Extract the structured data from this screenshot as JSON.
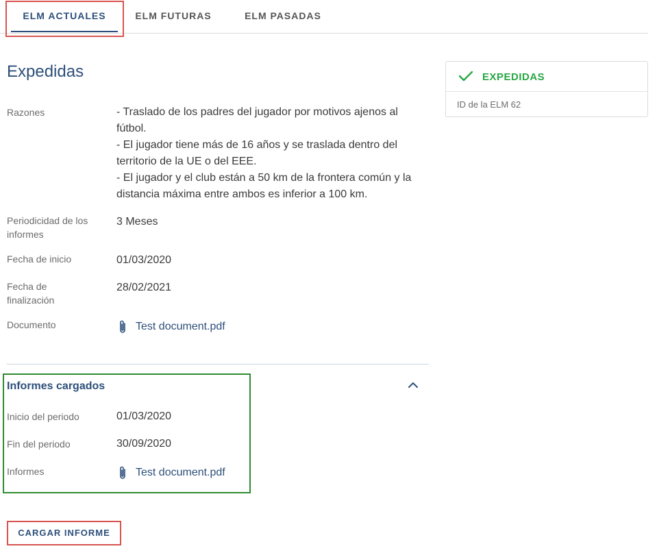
{
  "tabs": [
    {
      "label": "ELM ACTUALES",
      "active": true
    },
    {
      "label": "ELM FUTURAS",
      "active": false
    },
    {
      "label": "ELM PASADAS",
      "active": false
    }
  ],
  "main": {
    "title": "Expedidas",
    "fields": {
      "razones_label": "Razones",
      "razones": [
        "- Traslado de los padres del jugador por motivos ajenos al",
        "fútbol.",
        "- El jugador tiene más de 16 años y se traslada dentro del",
        "territorio de la UE o del EEE.",
        "- El jugador y el club están a 50 km de la frontera común y la",
        "distancia máxima entre ambos es inferior a 100 km."
      ],
      "periodicidad_label_1": "Periodicidad de los",
      "periodicidad_label_2": "informes",
      "periodicidad": "3 Meses",
      "fecha_inicio_label": "Fecha de inicio",
      "fecha_inicio": "01/03/2020",
      "fecha_fin_label_1": "Fecha de",
      "fecha_fin_label_2": "finalización",
      "fecha_fin": "28/02/2021",
      "documento_label": "Documento",
      "documento": "Test document.pdf"
    },
    "informes": {
      "title": "Informes cargados",
      "inicio_label": "Inicio del periodo",
      "inicio": "01/03/2020",
      "fin_label": "Fin del periodo",
      "fin": "30/09/2020",
      "informes_label": "Informes",
      "informes_doc": "Test document.pdf"
    },
    "upload_button": "CARGAR INFORME"
  },
  "status_card": {
    "status": "EXPEDIDAS",
    "id_text": "ID de la ELM 62"
  },
  "colors": {
    "primary": "#2d4f7a",
    "success": "#28a745",
    "highlight_red": "#d9534f",
    "highlight_green": "#2e8b2e"
  }
}
